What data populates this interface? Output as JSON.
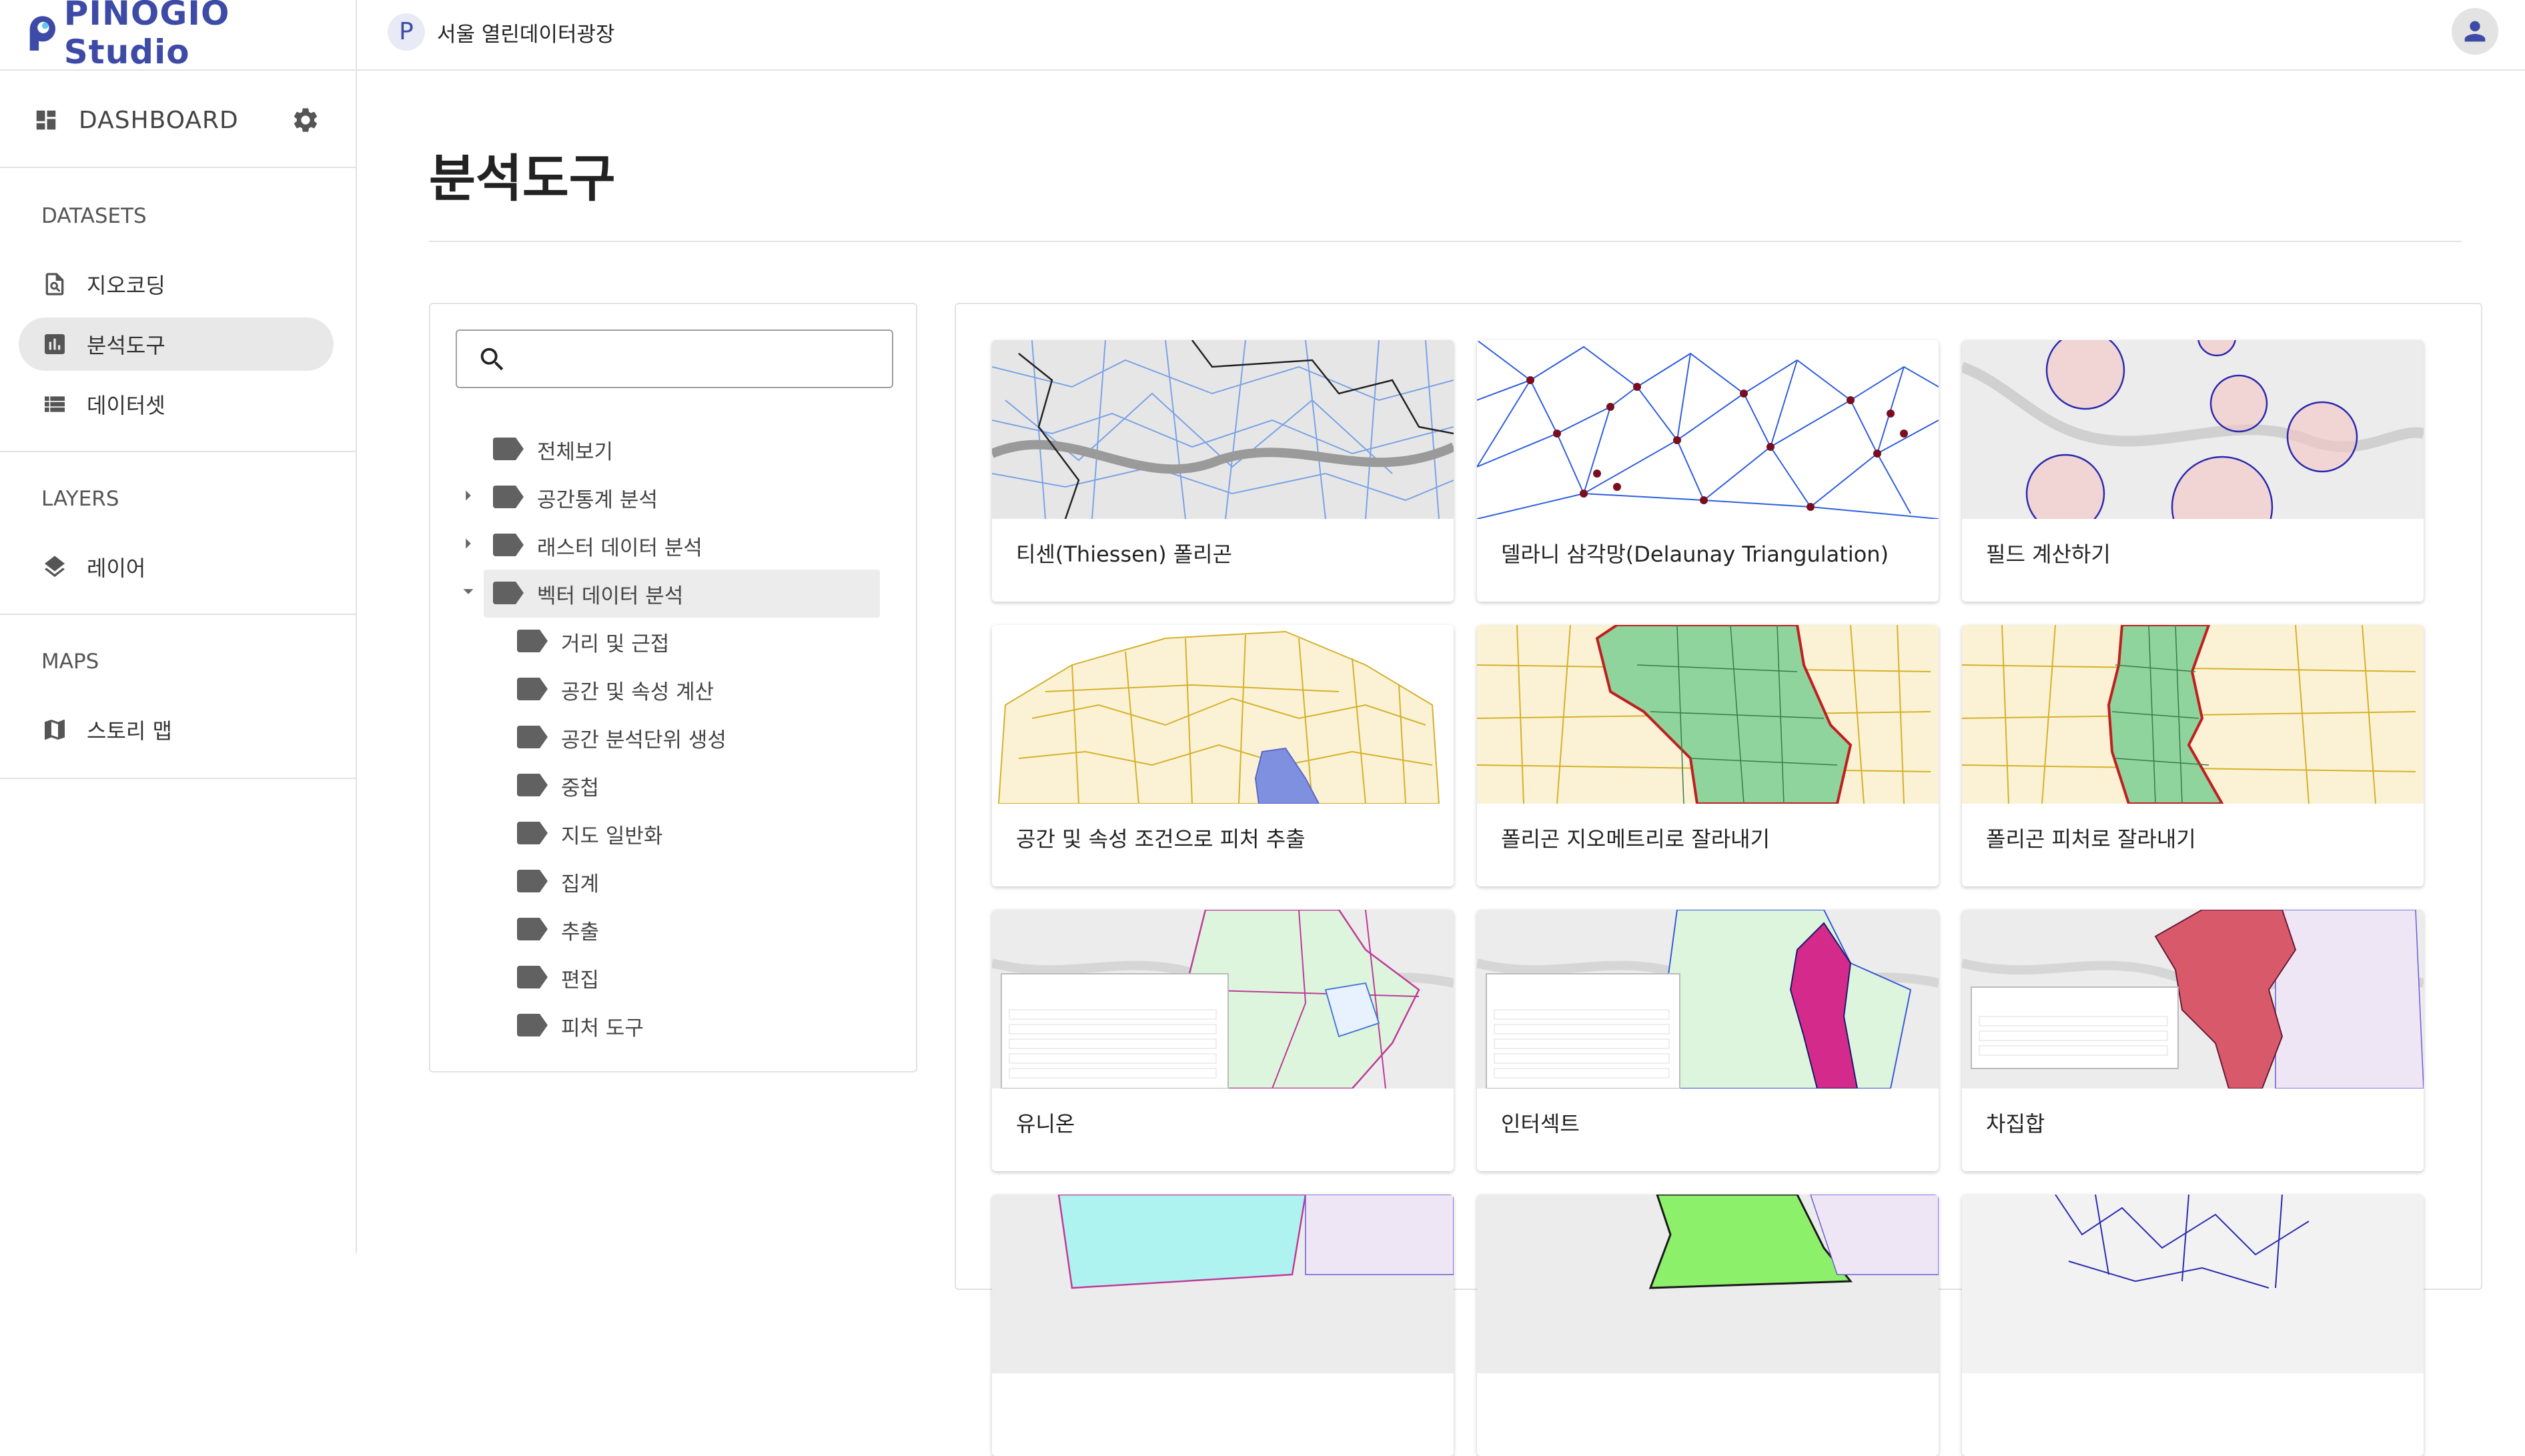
{
  "brand": {
    "name": "PINOGIO Studio"
  },
  "sidebar": {
    "dashboard_label": "DASHBOARD",
    "sections": [
      {
        "label": "DATASETS",
        "items": [
          {
            "label": "지오코딩",
            "icon": "geocode-search-icon"
          },
          {
            "label": "분석도구",
            "icon": "bar-chart-icon",
            "active": true
          },
          {
            "label": "데이터셋",
            "icon": "list-icon"
          }
        ]
      },
      {
        "label": "LAYERS",
        "items": [
          {
            "label": "레이어",
            "icon": "layers-icon"
          }
        ]
      },
      {
        "label": "MAPS",
        "items": [
          {
            "label": "스토리 맵",
            "icon": "map-icon"
          }
        ]
      }
    ]
  },
  "topbar": {
    "org_initial": "P",
    "org_name": "서울 열린데이터광장"
  },
  "page": {
    "title": "분석도구"
  },
  "search": {
    "placeholder": ""
  },
  "tree": [
    {
      "label": "전체보기",
      "level": 0,
      "caret": "none"
    },
    {
      "label": "공간통계 분석",
      "level": 0,
      "caret": "collapsed"
    },
    {
      "label": "래스터 데이터 분석",
      "level": 0,
      "caret": "collapsed"
    },
    {
      "label": "벡터 데이터 분석",
      "level": 0,
      "caret": "expanded",
      "selected": true
    },
    {
      "label": "거리 및 근접",
      "level": 1
    },
    {
      "label": "공간 및 속성 계산",
      "level": 1
    },
    {
      "label": "공간 분석단위 생성",
      "level": 1
    },
    {
      "label": "중첩",
      "level": 1
    },
    {
      "label": "지도 일반화",
      "level": 1
    },
    {
      "label": "집계",
      "level": 1
    },
    {
      "label": "추출",
      "level": 1
    },
    {
      "label": "편집",
      "level": 1
    },
    {
      "label": "피처 도구",
      "level": 1
    }
  ],
  "cards": [
    {
      "title": "티센(Thiessen) 폴리곤"
    },
    {
      "title": "델라니 삼각망(Delaunay Triangulation)"
    },
    {
      "title": "필드 계산하기"
    },
    {
      "title": "공간 및 속성 조건으로 피처 추출"
    },
    {
      "title": "폴리곤 지오메트리로 잘라내기"
    },
    {
      "title": "폴리곤 피처로 잘라내기"
    },
    {
      "title": "유니온"
    },
    {
      "title": "인터섹트"
    },
    {
      "title": "차집합"
    }
  ],
  "colors": {
    "brand": "#3d4aa6",
    "active_nav": "#e8e8e8",
    "selected_tree": "#ececec"
  }
}
